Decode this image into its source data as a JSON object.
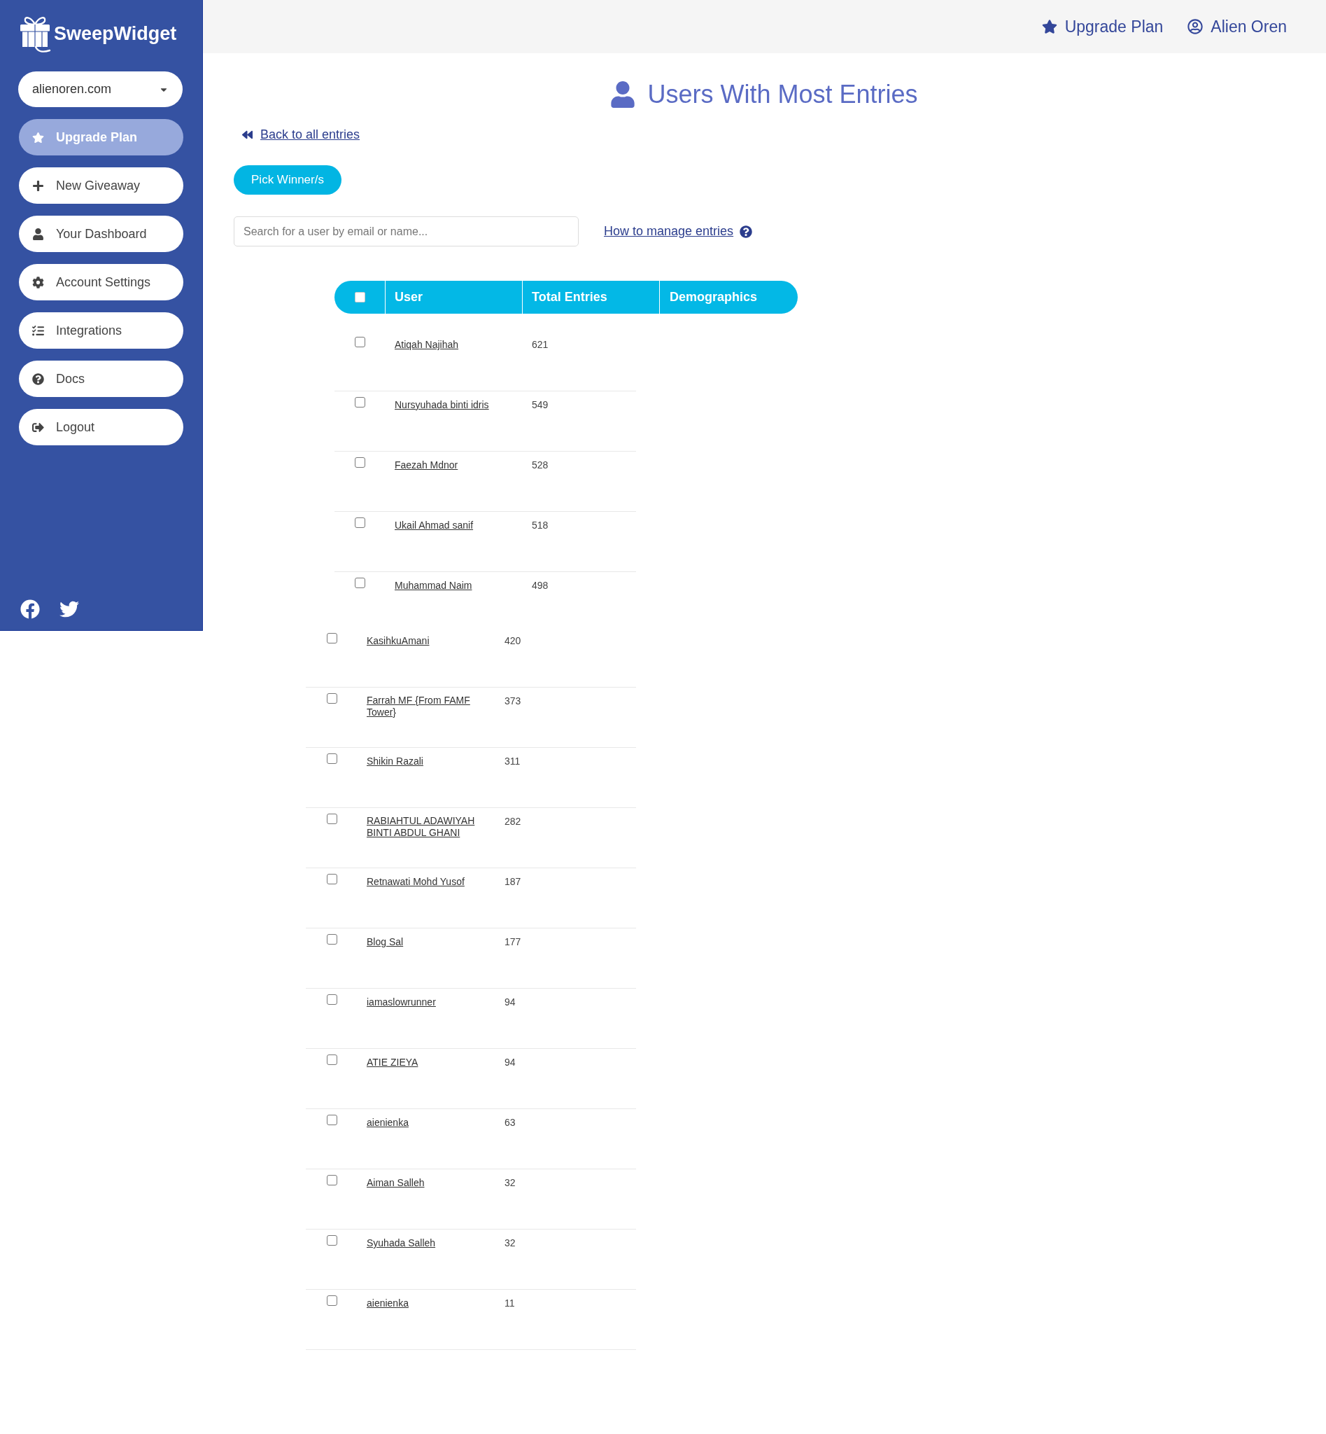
{
  "sidebar": {
    "logo": {
      "text": "SweepWidget"
    },
    "site_select": {
      "value": "alienoren.com"
    },
    "items": [
      {
        "label": "Upgrade Plan",
        "kind": "upgrade"
      },
      {
        "label": "New Giveaway",
        "kind": "link"
      },
      {
        "label": "Your Dashboard",
        "kind": "link"
      },
      {
        "label": "Account Settings",
        "kind": "link"
      },
      {
        "label": "Integrations",
        "kind": "link"
      },
      {
        "label": "Docs",
        "kind": "link"
      },
      {
        "label": "Logout",
        "kind": "link"
      }
    ]
  },
  "top_bar": {
    "links": [
      {
        "label": "Upgrade Plan"
      },
      {
        "label": "Alien Oren"
      }
    ]
  },
  "page": {
    "title": "Users With Most Entries",
    "back_link": "Back to all entries",
    "pick_button": "Pick Winner/s",
    "search": {
      "placeholder": "Search for a user by email or name..."
    },
    "help_link": "How to manage entries"
  },
  "table": {
    "select_all": {
      "checked": false
    },
    "columns": [
      "User",
      "Total Entries",
      "Demographics"
    ],
    "rows": [
      {
        "user": "Atiqah Najihah",
        "total_entries": "621",
        "checked": false
      },
      {
        "user": "Nursyuhada binti idris",
        "total_entries": "549",
        "checked": false
      },
      {
        "user": "Faezah Mdnor",
        "total_entries": "528",
        "checked": false
      },
      {
        "user": "Ukail Ahmad sanif",
        "total_entries": "518",
        "checked": false
      },
      {
        "user": "Muhammad Naim",
        "total_entries": "498",
        "checked": false
      }
    ]
  },
  "table_continued": {
    "rows": [
      {
        "user": "KasihkuAmani",
        "total_entries": "420",
        "checked": false
      },
      {
        "user": "Farrah MF {From FAMF Tower}",
        "total_entries": "373",
        "checked": false
      },
      {
        "user": "Shikin Razali",
        "total_entries": "311",
        "checked": false
      },
      {
        "user": "RABIAHTUL ADAWIYAH BINTI ABDUL GHANI",
        "total_entries": "282",
        "checked": false
      },
      {
        "user": "Retnawati Mohd Yusof",
        "total_entries": "187",
        "checked": false
      },
      {
        "user": "Blog Sal",
        "total_entries": "177",
        "checked": false
      },
      {
        "user": "iamaslowrunner",
        "total_entries": "94",
        "checked": false
      },
      {
        "user": "ATIE ZIEYA",
        "total_entries": "94",
        "checked": false
      },
      {
        "user": "aienienka",
        "total_entries": "63",
        "checked": false
      },
      {
        "user": "Aiman Salleh",
        "total_entries": "32",
        "checked": false
      },
      {
        "user": "Syuhada Salleh",
        "total_entries": "32",
        "checked": false
      },
      {
        "user": "aienienka",
        "total_entries": "11",
        "checked": false
      }
    ]
  }
}
